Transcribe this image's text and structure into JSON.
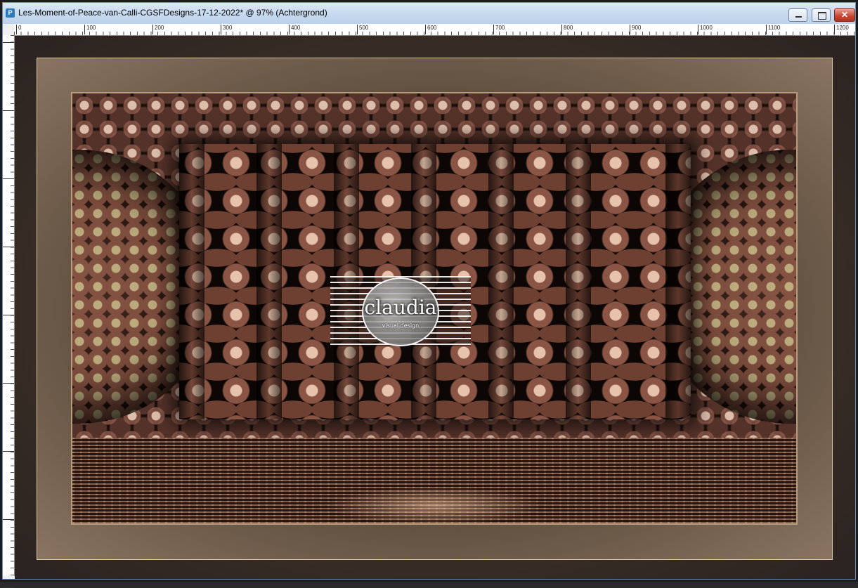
{
  "window": {
    "title": "Les-Moment-of-Peace-van-Calli-CGSFDesigns-17-12-2022* @  97% (Achtergrond)",
    "app_icon": "paintshop-icon",
    "buttons": {
      "minimize": "minimize-icon",
      "maximize": "maximize-icon",
      "close": "close-icon",
      "close_glyph": "✕"
    }
  },
  "ruler": {
    "top_labels": [
      "0",
      "100",
      "200",
      "300",
      "400",
      "500",
      "600",
      "700",
      "800",
      "900",
      "1000",
      "1100",
      "1200"
    ]
  },
  "canvas": {
    "zoom_percent": 97,
    "layer": "Achtergrond",
    "watermark": {
      "text": "claudia",
      "subtext": "visual design"
    },
    "colors": {
      "frame_light": "#d9c4a6",
      "frame_gold": "#b89c7c",
      "dark": "#120b08",
      "bronze": "#8a7563"
    }
  }
}
